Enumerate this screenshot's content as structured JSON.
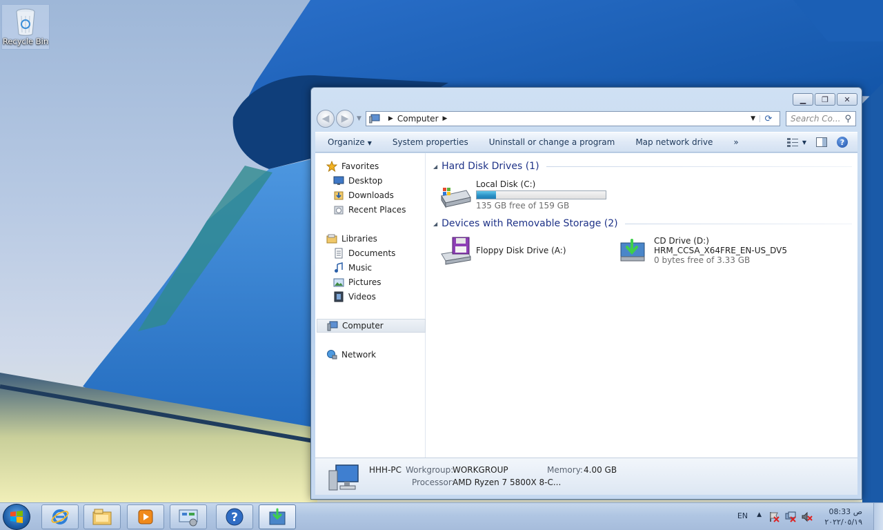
{
  "desktop": {
    "icons": [
      {
        "label": "Recycle Bin",
        "icon": "recycle-bin-icon"
      }
    ]
  },
  "window": {
    "address": {
      "path": "Computer"
    },
    "search": {
      "placeholder": "Search Co..."
    },
    "commands": {
      "organize": "Organize",
      "system_properties": "System properties",
      "uninstall": "Uninstall or change a program",
      "map_drive": "Map network drive",
      "more": "»"
    },
    "nav": {
      "favorites": "Favorites",
      "desktop": "Desktop",
      "downloads": "Downloads",
      "recent_places": "Recent Places",
      "libraries": "Libraries",
      "documents": "Documents",
      "music": "Music",
      "pictures": "Pictures",
      "videos": "Videos",
      "computer": "Computer",
      "network": "Network"
    },
    "groups": {
      "hard_disk": "Hard Disk Drives (1)",
      "removable": "Devices with Removable Storage (2)"
    },
    "drives": {
      "local_c": {
        "name": "Local Disk (C:)",
        "free": "135 GB free of 159 GB",
        "used_fraction": 0.15
      },
      "floppy": {
        "name": "Floppy Disk Drive (A:)"
      },
      "cd": {
        "name": "CD Drive (D:)",
        "label": "HRM_CCSA_X64FRE_EN-US_DV5",
        "free": "0 bytes free of 3.33 GB"
      }
    },
    "details": {
      "pc_name": "HHH-PC",
      "workgroup_label": "Workgroup:",
      "workgroup": "WORKGROUP",
      "memory_label": "Memory:",
      "memory": "4.00 GB",
      "processor_label": "Processor:",
      "processor": "AMD Ryzen 7 5800X 8-C..."
    }
  },
  "taskbar": {
    "language": "EN",
    "time": "08:33 ص",
    "date": "٢٠٢٢/٠٥/١٩"
  },
  "colors": {
    "group_header": "#1e3287",
    "command_text": "#1e395b",
    "progress_fill": "#2a8fc4"
  }
}
